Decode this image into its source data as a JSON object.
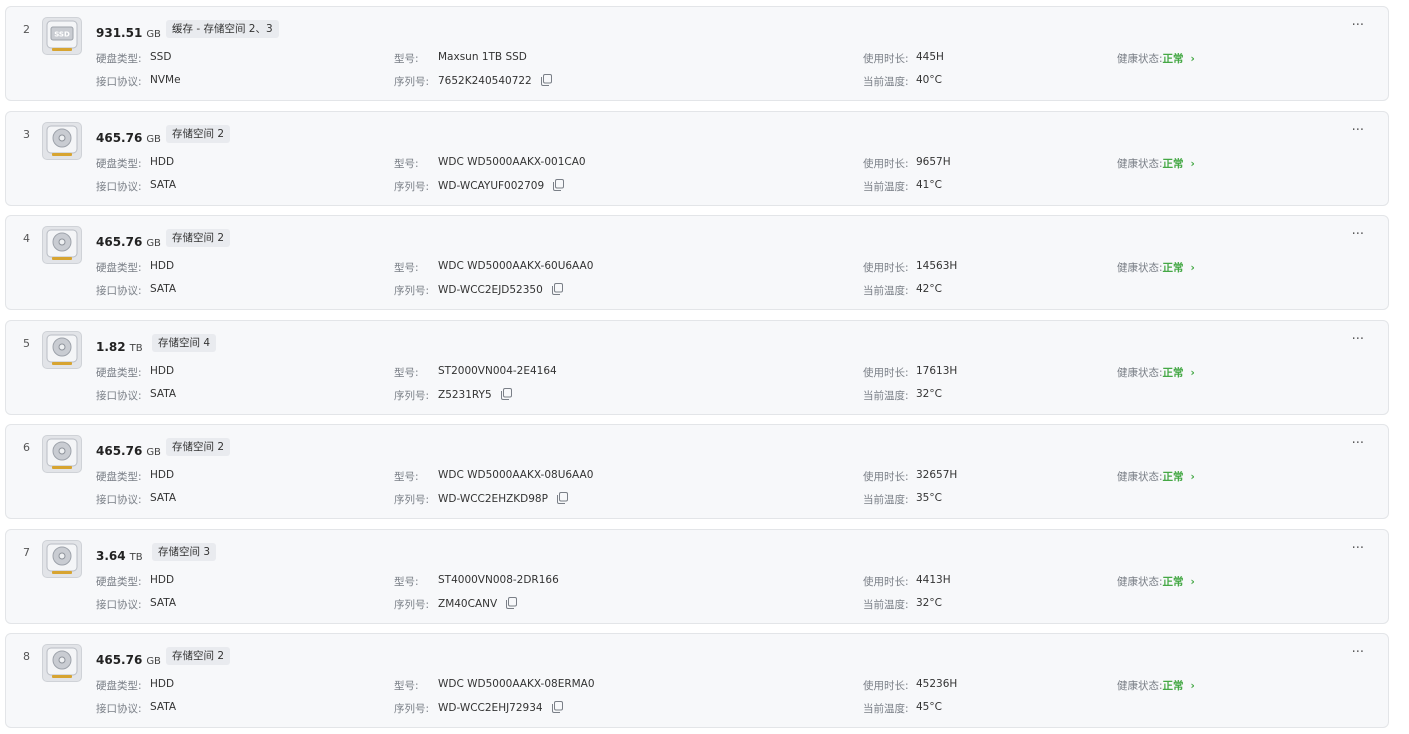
{
  "labels": {
    "disk_type": "硬盘类型:",
    "model": "型号:",
    "uptime": "使用时长:",
    "health": "健康状态:",
    "interface": "接口协议:",
    "serial": "序列号:",
    "temp": "当前温度:"
  },
  "more_glyph": "···",
  "health_chevron": "›",
  "colors": {
    "healthy": "#45a845",
    "card_bg": "#f7f8fa",
    "tag_bg": "#e9ebef"
  },
  "icons": {
    "disk": "hard-disk-icon",
    "copy": "copy-icon",
    "more": "more-options-icon"
  },
  "disks": [
    {
      "index": "2",
      "capacity": "931.51",
      "unit": "GB",
      "tag": "缓存 - 存储空间 2、3",
      "disk_type": "SSD",
      "interface": "NVMe",
      "model": "Maxsun 1TB SSD",
      "serial": "7652K240540722",
      "uptime": "445H",
      "temp": "40°C",
      "health": "正常",
      "ssd": true
    },
    {
      "index": "3",
      "capacity": "465.76",
      "unit": "GB",
      "tag": "存储空间 2",
      "disk_type": "HDD",
      "interface": "SATA",
      "model": "WDC WD5000AAKX-001CA0",
      "serial": "WD-WCAYUF002709",
      "uptime": "9657H",
      "temp": "41°C",
      "health": "正常",
      "ssd": false
    },
    {
      "index": "4",
      "capacity": "465.76",
      "unit": "GB",
      "tag": "存储空间 2",
      "disk_type": "HDD",
      "interface": "SATA",
      "model": "WDC WD5000AAKX-60U6AA0",
      "serial": "WD-WCC2EJD52350",
      "uptime": "14563H",
      "temp": "42°C",
      "health": "正常",
      "ssd": false
    },
    {
      "index": "5",
      "capacity": "1.82",
      "unit": "TB",
      "tag": "存储空间 4",
      "disk_type": "HDD",
      "interface": "SATA",
      "model": "ST2000VN004-2E4164",
      "serial": "Z5231RY5",
      "uptime": "17613H",
      "temp": "32°C",
      "health": "正常",
      "ssd": false
    },
    {
      "index": "6",
      "capacity": "465.76",
      "unit": "GB",
      "tag": "存储空间 2",
      "disk_type": "HDD",
      "interface": "SATA",
      "model": "WDC WD5000AAKX-08U6AA0",
      "serial": "WD-WCC2EHZKD98P",
      "uptime": "32657H",
      "temp": "35°C",
      "health": "正常",
      "ssd": false
    },
    {
      "index": "7",
      "capacity": "3.64",
      "unit": "TB",
      "tag": "存储空间 3",
      "disk_type": "HDD",
      "interface": "SATA",
      "model": "ST4000VN008-2DR166",
      "serial": "ZM40CANV",
      "uptime": "4413H",
      "temp": "32°C",
      "health": "正常",
      "ssd": false
    },
    {
      "index": "8",
      "capacity": "465.76",
      "unit": "GB",
      "tag": "存储空间 2",
      "disk_type": "HDD",
      "interface": "SATA",
      "model": "WDC WD5000AAKX-08ERMA0",
      "serial": "WD-WCC2EHJ72934",
      "uptime": "45236H",
      "temp": "45°C",
      "health": "正常",
      "ssd": false
    }
  ]
}
